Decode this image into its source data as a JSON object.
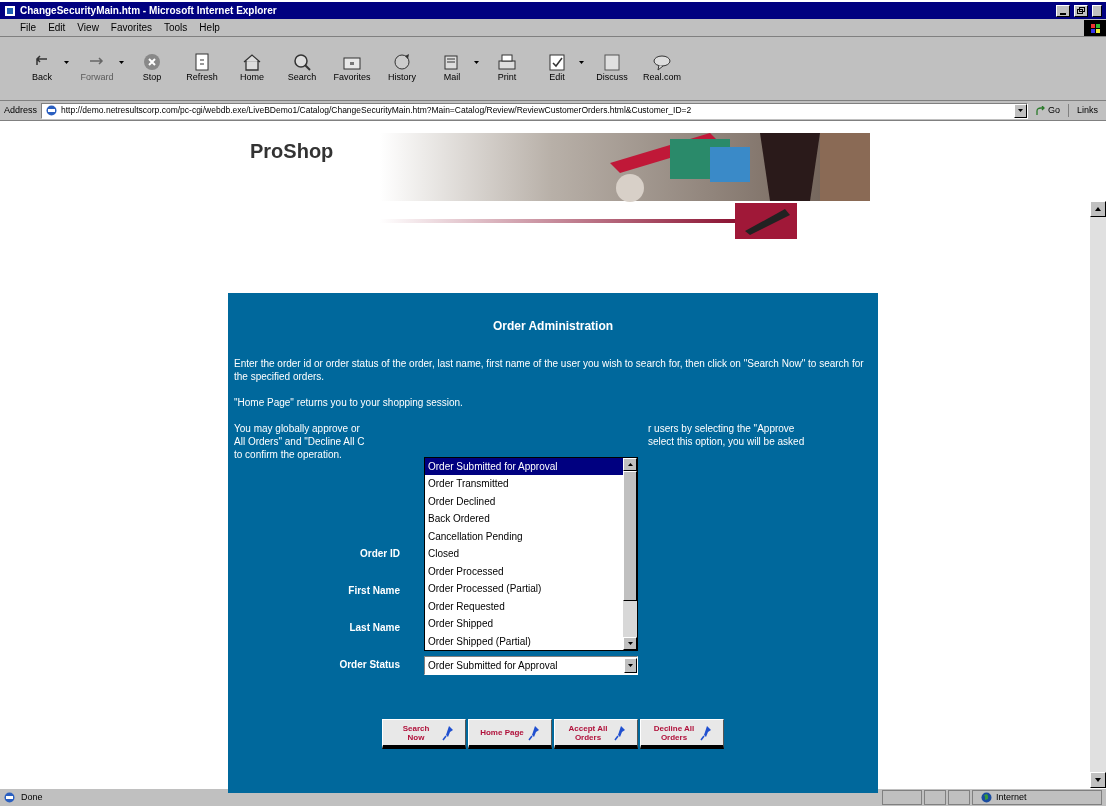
{
  "window": {
    "title": "ChangeSecurityMain.htm - Microsoft Internet Explorer"
  },
  "menu": [
    "File",
    "Edit",
    "View",
    "Favorites",
    "Tools",
    "Help"
  ],
  "toolbar": [
    {
      "label": "Back",
      "disabled": false,
      "dropdown": true
    },
    {
      "label": "Forward",
      "disabled": true,
      "dropdown": true
    },
    {
      "label": "Stop",
      "disabled": false,
      "dropdown": false
    },
    {
      "label": "Refresh",
      "disabled": false,
      "dropdown": false
    },
    {
      "label": "Home",
      "disabled": false,
      "dropdown": false
    },
    {
      "label": "Search",
      "disabled": false,
      "dropdown": false
    },
    {
      "label": "Favorites",
      "disabled": false,
      "dropdown": false
    },
    {
      "label": "History",
      "disabled": false,
      "dropdown": false
    },
    {
      "label": "Mail",
      "disabled": false,
      "dropdown": true
    },
    {
      "label": "Print",
      "disabled": false,
      "dropdown": false
    },
    {
      "label": "Edit",
      "disabled": false,
      "dropdown": true
    },
    {
      "label": "Discuss",
      "disabled": false,
      "dropdown": false
    },
    {
      "label": "Real.com",
      "disabled": false,
      "dropdown": false
    }
  ],
  "address_bar": {
    "label": "Address",
    "url": "http://demo.netresultscorp.com/pc-cgi/webdb.exe/LiveBDemo1/Catalog/ChangeSecurityMain.htm?Main=Catalog/Review/ReviewCustomerOrders.html&Customer_ID=2",
    "go": "Go",
    "links": "Links"
  },
  "page": {
    "logo": "ProShop",
    "panel": {
      "title": "Order Administration",
      "paragraph_1": "Enter the order id or order status of the order, last name, first name of the user you wish to search for, then click on \"Search Now\" to search for the specified orders.",
      "paragraph_2": "\"Home Page\" returns you to your shopping session.",
      "paragraph_3_fragments": [
        {
          "left": "You may globally approve or",
          "right": "r users by selecting the \"Approve"
        },
        {
          "left": "All Orders\" and \"Decline All C",
          "right": "select this option, you will be asked"
        },
        {
          "left": "to confirm the operation."
        }
      ],
      "fields": [
        "Order ID",
        "First Name",
        "Last Name",
        "Order Status"
      ],
      "order_status": {
        "value": "Order Submitted for Approval",
        "expanded": true,
        "options": [
          {
            "label": "Order Submitted for Approval",
            "selected": true
          },
          {
            "label": "Order Transmitted",
            "selected": false
          },
          {
            "label": "Order Declined",
            "selected": false
          },
          {
            "label": "Back Ordered",
            "selected": false
          },
          {
            "label": "Cancellation Pending",
            "selected": false
          },
          {
            "label": "Closed",
            "selected": false
          },
          {
            "label": "Order Processed",
            "selected": false
          },
          {
            "label": "Order Processed (Partial)",
            "selected": false
          },
          {
            "label": "Order Requested",
            "selected": false
          },
          {
            "label": "Order Shipped",
            "selected": false
          },
          {
            "label": "Order Shipped (Partial)",
            "selected": false
          }
        ]
      },
      "buttons": [
        "Search Now",
        "Home Page",
        "Accept All Orders",
        "Decline All Orders"
      ]
    }
  },
  "status_bar": {
    "text": "Done",
    "zone": "Internet"
  }
}
